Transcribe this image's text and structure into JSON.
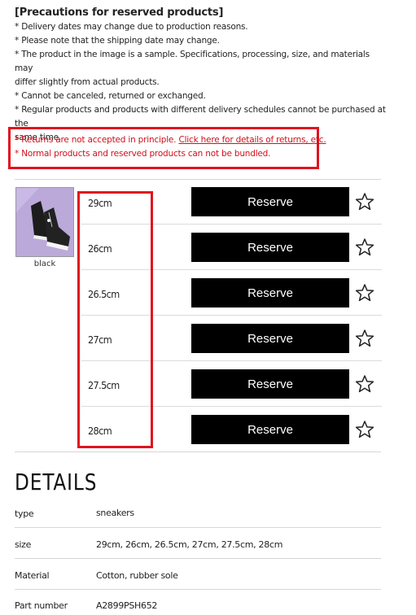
{
  "precautions": {
    "title": "[Precautions for reserved products]",
    "lines": [
      "* Delivery dates may change due to production reasons.",
      "* Please note that the shipping date may change.",
      "* The product in the image is a sample. Specifications, processing, size, and materials may",
      "differ slightly from actual products.",
      "* Cannot be canceled, returned or exchanged.",
      "* Regular products and products with different delivery schedules cannot be purchased at the",
      "same time."
    ]
  },
  "notices": {
    "returns_prefix": "* Returns are not accepted in principle. ",
    "returns_link": "Click here for details of returns, etc.",
    "bundle": "* Normal products and reserved products can not be bundled."
  },
  "product": {
    "color_label": "black",
    "sizes": [
      "29cm",
      "26cm",
      "26.5cm",
      "27cm",
      "27.5cm",
      "28cm"
    ],
    "reserve_label": "Reserve"
  },
  "details": {
    "title": "DETAILS",
    "rows": [
      {
        "key": "type",
        "value": "sneakers"
      },
      {
        "key": "size",
        "value": "29cm, 26cm, 26.5cm, 27cm, 27.5cm, 28cm"
      },
      {
        "key": "Material",
        "value": "Cotton, rubber sole"
      },
      {
        "key": "Part number",
        "value": "A2899PSH652"
      }
    ]
  },
  "colors": {
    "accent_red": "#e0141e",
    "button_black": "#000000",
    "thumb_bg": "#b9a8d8"
  },
  "icons": {
    "favorite": "star-outline-icon"
  }
}
